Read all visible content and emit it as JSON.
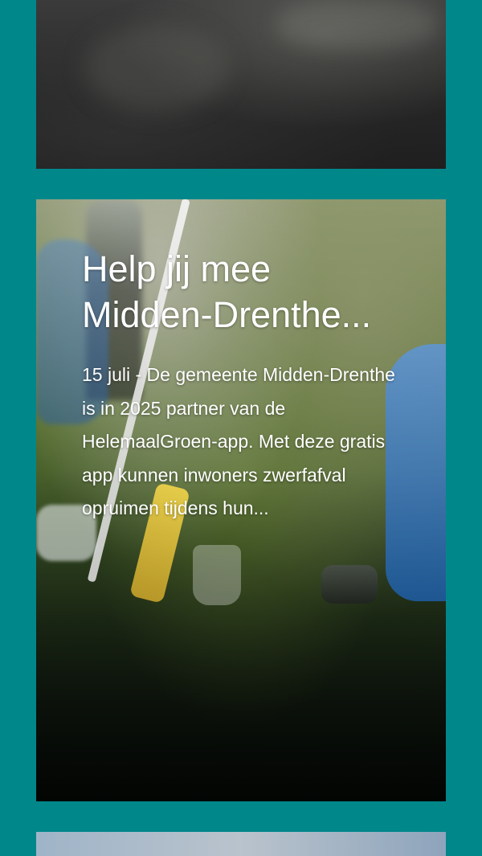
{
  "colors": {
    "page_background": "#00878a",
    "card_text": "#ffffff"
  },
  "cards": [
    {
      "id": "top-card",
      "title": "",
      "excerpt": ""
    },
    {
      "id": "featured-card",
      "title": "Help jij mee Midden-Drenthe...",
      "excerpt": "15 juli - De gemeente Midden-Drenthe is in 2025 partner van de HelemaalGroen-app. Met deze gratis app kunnen inwoners zwerfafval opruimen tijdens hun..."
    },
    {
      "id": "bottom-card",
      "title": "",
      "excerpt": ""
    }
  ]
}
